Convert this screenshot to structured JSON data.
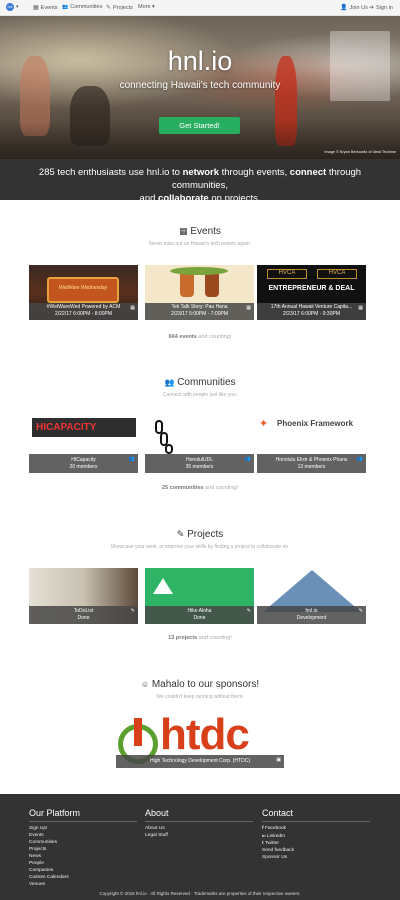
{
  "navbar": {
    "logo_text": "hnl",
    "items": [
      {
        "icon": "calendar-icon",
        "glyph": "▦",
        "label": "Events"
      },
      {
        "icon": "users-icon",
        "glyph": "👥",
        "label": "Communities"
      },
      {
        "icon": "wrench-icon",
        "glyph": "✎",
        "label": "Projects"
      },
      {
        "label": "More ▾"
      }
    ],
    "join_label": "Join Us",
    "signin_label": "Sign in"
  },
  "hero": {
    "title": "hnl.io",
    "subtitle": "connecting Hawaii's tech community",
    "cta": "Get Started!",
    "credit": "Image © Bryan Berkowitz of Ideal Techrise",
    "colors": {
      "cta": "#27ae60"
    }
  },
  "tagline": {
    "count_prefix": "285 tech enthusiasts use hnl.io to ",
    "network": "network",
    "mid1": " through events, ",
    "connect": "connect",
    "mid2": " through communities,",
    "and": "and ",
    "collaborate": "collaborate",
    "end": " on projects."
  },
  "events": {
    "title": "Events",
    "subtitle": "Never miss out on Hawaii's tech events again.",
    "items": [
      {
        "name": "#WetWareWed Powered by ACM",
        "time": "2/22/17 6:00PM - 8:00PM",
        "image_text": "WetWare Wednesday"
      },
      {
        "name": "Tek Talk Story: Pau Hana",
        "time": "2/23/17 5:00PM - 7:00PM",
        "image_text": ""
      },
      {
        "name": "17th Annual Hawaii Venture Capita...",
        "time": "2/23/17 6:00PM - 9:30PM",
        "image_text": "ENTREPRENEUR & DEAL"
      }
    ],
    "count": "664 events",
    "count_suffix": " and counting!"
  },
  "communities": {
    "title": "Communities",
    "subtitle": "Connect with people just like you.",
    "items": [
      {
        "name": "HICapacity",
        "members": "20 members",
        "logo": "HICAPACITY"
      },
      {
        "name": "HonolulUDL",
        "members": "35 members",
        "logo": ""
      },
      {
        "name": "Honolulu Elixir & Phoenix Phans",
        "members": "13 members",
        "logo": "Phoenix Framework"
      }
    ],
    "count": "25 communities",
    "count_suffix": " and counting!"
  },
  "projects": {
    "title": "Projects",
    "subtitle": "Showcase your work, or improve your skills by finding a project to collaborate on.",
    "items": [
      {
        "name": "ToDoList",
        "status": "Done"
      },
      {
        "name": "Hike Aloha",
        "status": "Done"
      },
      {
        "name": "hnl.io",
        "status": "Development"
      }
    ],
    "count": "13 projects",
    "count_suffix": " and counting!"
  },
  "sponsors": {
    "title": "Mahalo to our sponsors!",
    "subtitle": "We couldn't keep running without them.",
    "items": [
      {
        "name": "High Technology Development Corp. (HTDC)",
        "logo": "htdc"
      }
    ]
  },
  "footer": {
    "platform_title": "Our Platform",
    "platform_links": [
      "Sign Up!",
      "Events",
      "Communities",
      "Projects",
      "News",
      "People",
      "Companies",
      "Custom Calendars",
      "Venues"
    ],
    "about_title": "About",
    "about_links": [
      "About Us",
      "Legal Stuff"
    ],
    "contact_title": "Contact",
    "contact_links": [
      {
        "icon": "facebook-icon",
        "glyph": "f",
        "label": "Facebook"
      },
      {
        "icon": "linkedin-icon",
        "glyph": "in",
        "label": "LinkedIn"
      },
      {
        "icon": "twitter-icon",
        "glyph": "t",
        "label": "Twitter"
      },
      {
        "label": "Send feedback"
      },
      {
        "label": "Sponsor Us"
      }
    ],
    "copyright": "Copyright © 2016 hnl.io · All Rights Reserved · Trademarks are properties of their respective owners."
  }
}
